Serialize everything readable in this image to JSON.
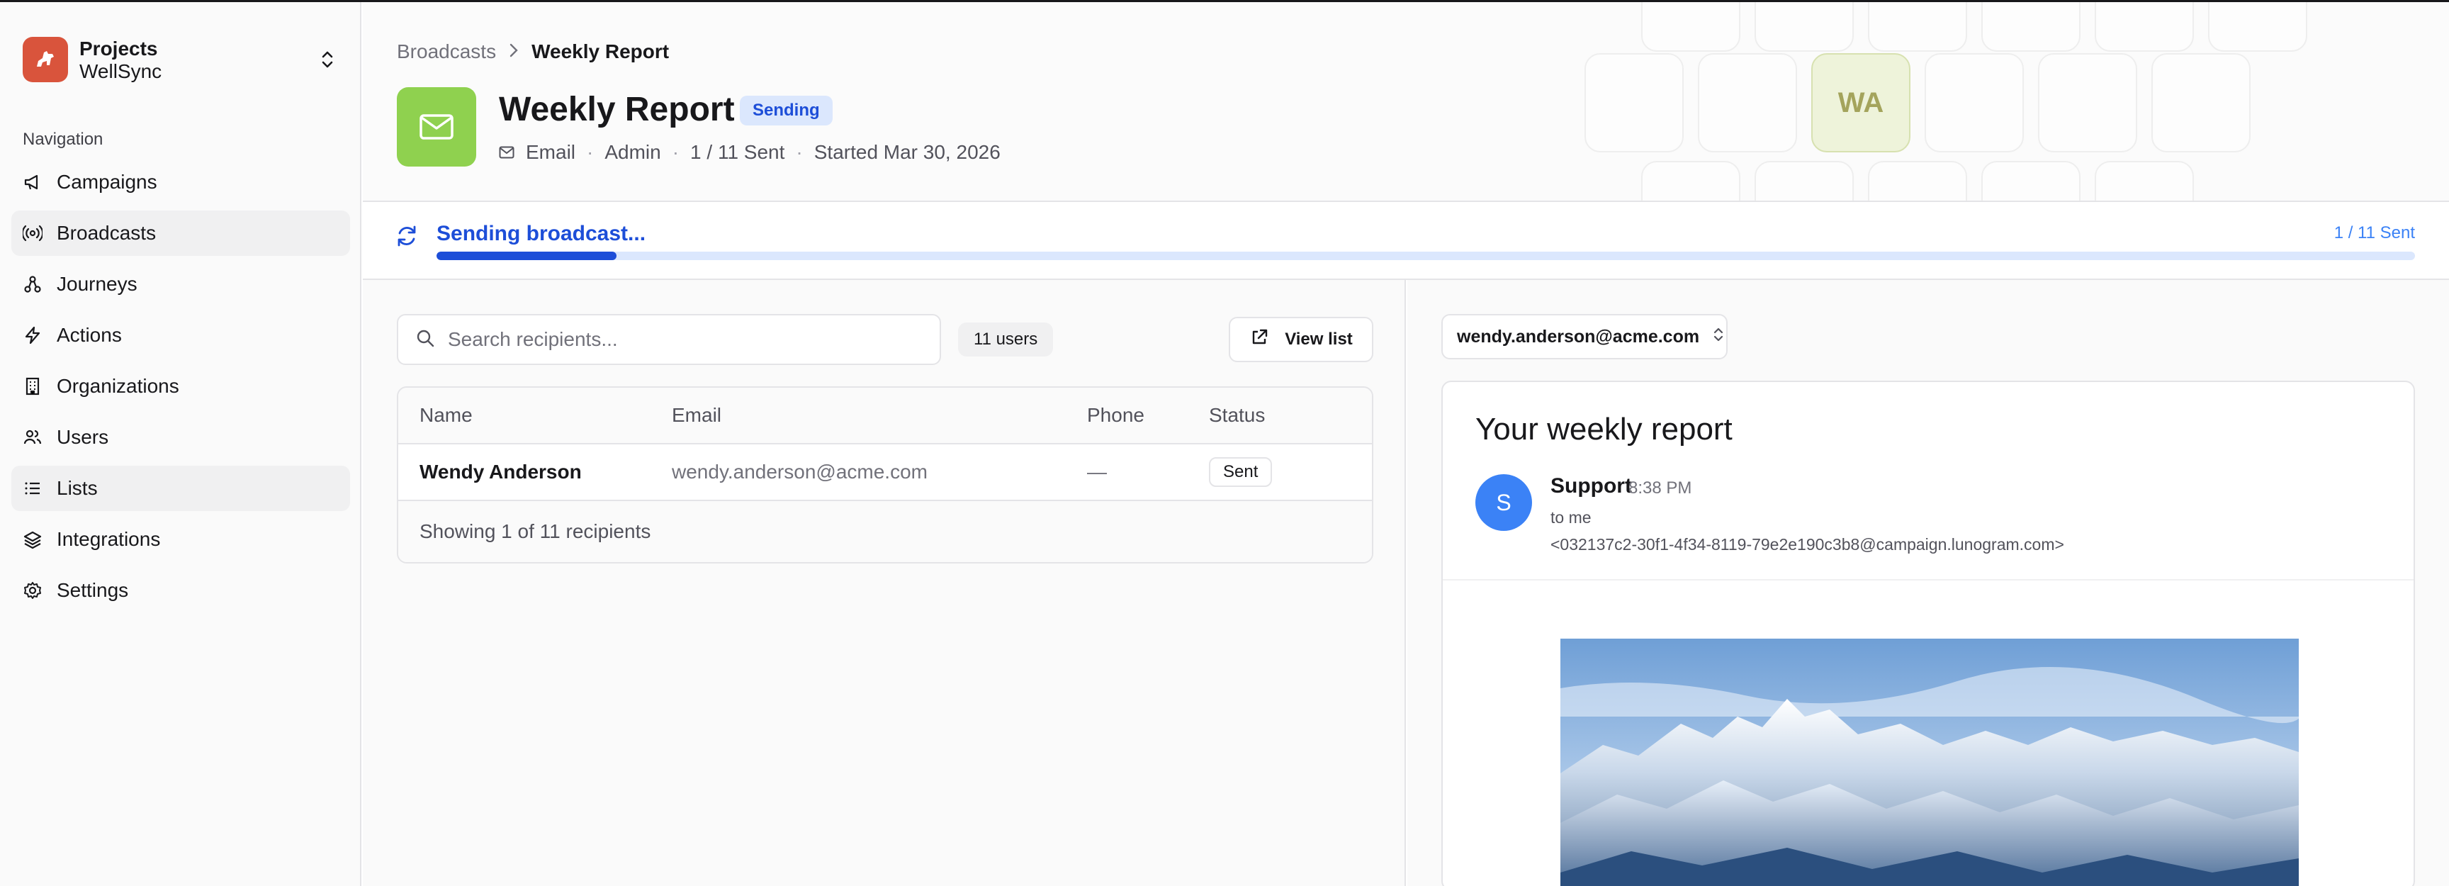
{
  "sidebar": {
    "project_title": "Projects",
    "project_name": "WellSync",
    "nav_heading": "Navigation",
    "items": [
      {
        "label": "Campaigns",
        "icon": "megaphone-icon"
      },
      {
        "label": "Broadcasts",
        "icon": "broadcast-icon",
        "active": true
      },
      {
        "label": "Journeys",
        "icon": "journey-icon"
      },
      {
        "label": "Actions",
        "icon": "lightning-icon"
      },
      {
        "label": "Organizations",
        "icon": "building-icon"
      },
      {
        "label": "Users",
        "icon": "users-icon"
      },
      {
        "label": "Lists",
        "icon": "list-icon",
        "active": true
      },
      {
        "label": "Integrations",
        "icon": "layers-icon"
      },
      {
        "label": "Settings",
        "icon": "gear-icon"
      }
    ]
  },
  "breadcrumb": {
    "parent": "Broadcasts",
    "current": "Weekly Report"
  },
  "header": {
    "title": "Weekly Report",
    "status": "Sending",
    "channel": "Email",
    "author": "Admin",
    "sent_count": "1 / 11 Sent",
    "started": "Started Mar 30, 2026",
    "avatar_initials": "WA"
  },
  "progress": {
    "label": "Sending broadcast...",
    "count": "1 / 11 Sent",
    "fraction": 0.0909
  },
  "recipients": {
    "search_placeholder": "Search recipients...",
    "users_count": "11 users",
    "view_list_label": "View list",
    "columns": {
      "name": "Name",
      "email": "Email",
      "phone": "Phone",
      "status": "Status"
    },
    "rows": [
      {
        "name": "Wendy Anderson",
        "email": "wendy.anderson@acme.com",
        "phone": "—",
        "status": "Sent"
      }
    ],
    "footer": "Showing 1 of 11 recipients"
  },
  "preview": {
    "selected_recipient": "wendy.anderson@acme.com",
    "subject": "Your weekly report",
    "sender_initial": "S",
    "sender_name": "Support",
    "time": "8:38 PM",
    "to": "to me",
    "from_address": "<032137c2-30f1-4f34-8119-79e2e190c3b8@campaign.lunogram.com>"
  },
  "colors": {
    "brand": "#d9543c",
    "email_badge": "#8fd14f",
    "accent_blue": "#1d4ed8",
    "progress_track": "#dbe7fd"
  }
}
